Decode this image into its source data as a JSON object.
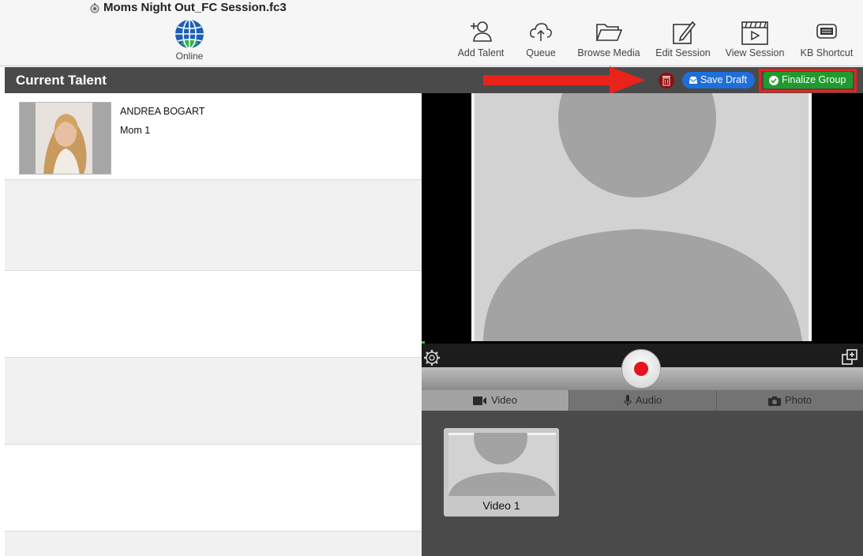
{
  "window": {
    "title": "Moms Night Out_FC Session.fc3",
    "doc_icon": "session-file-icon"
  },
  "toolbar": {
    "status_label": "Online",
    "status_icon": "globe-icon",
    "items": [
      {
        "label": "Add Talent",
        "icon": "add-person-icon"
      },
      {
        "label": "Queue",
        "icon": "cloud-upload-icon"
      },
      {
        "label": "Browse Media",
        "icon": "folder-icon"
      },
      {
        "label": "Edit Session",
        "icon": "edit-icon"
      },
      {
        "label": "View Session",
        "icon": "video-clapper-icon"
      },
      {
        "label": "KB Shortcut",
        "icon": "keyboard-icon"
      }
    ]
  },
  "header": {
    "title": "Current Talent",
    "save_draft": "Save Draft",
    "finalize": "Finalize Group",
    "colors": {
      "save": "#1e6fd9",
      "finalize": "#1f9a2e",
      "trash": "#8b1010",
      "highlight": "#e8231a"
    }
  },
  "talent": [
    {
      "name": "ANDREA BOGART",
      "role": "Mom 1"
    }
  ],
  "recorder": {
    "tabs": [
      {
        "label": "Video",
        "icon": "video-camera-icon",
        "active": true
      },
      {
        "label": "Audio",
        "icon": "microphone-icon",
        "active": false
      },
      {
        "label": "Photo",
        "icon": "camera-icon",
        "active": false
      }
    ],
    "record_color": "#e4151b"
  },
  "media": {
    "items": [
      {
        "label": "Video 1"
      }
    ]
  }
}
